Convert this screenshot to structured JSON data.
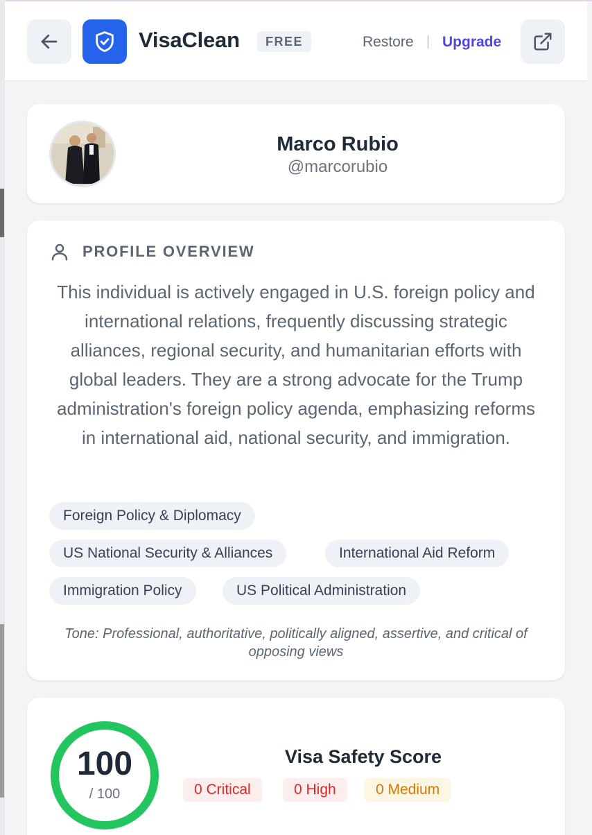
{
  "header": {
    "brand": "VisaClean",
    "plan_badge": "FREE",
    "restore_label": "Restore",
    "separator": "|",
    "upgrade_label": "Upgrade",
    "back_icon": "arrow-left-icon",
    "logo_icon": "shield-check-icon",
    "external_icon": "external-link-icon"
  },
  "profile": {
    "name": "Marco Rubio",
    "handle": "@marcorubio"
  },
  "overview": {
    "title": "PROFILE OVERVIEW",
    "icon": "user-icon",
    "summary": "This individual is actively engaged in U.S. foreign policy and international relations, frequently discussing strategic alliances, regional security, and humanitarian efforts with global leaders. They are a strong advocate for the Trump administration's foreign policy agenda, emphasizing reforms in international aid, national security, and immigration.",
    "tags": [
      "Foreign Policy & Diplomacy",
      "US National Security & Alliances",
      "International Aid Reform",
      "Immigration Policy",
      "US Political Administration"
    ],
    "tone": "Tone: Professional, authoritative, politically aligned, assertive, and critical of opposing views"
  },
  "score": {
    "value": "100",
    "max": "/ 100",
    "fraction": 1.0,
    "title": "Visa Safety Score",
    "critical": "0 Critical",
    "high": "0 High",
    "medium": "0 Medium"
  },
  "colors": {
    "accent": "#2563eb",
    "upgrade": "#4f46e5",
    "score_ring": "#22c55e",
    "critical": "#dc2626",
    "medium": "#d97706"
  }
}
